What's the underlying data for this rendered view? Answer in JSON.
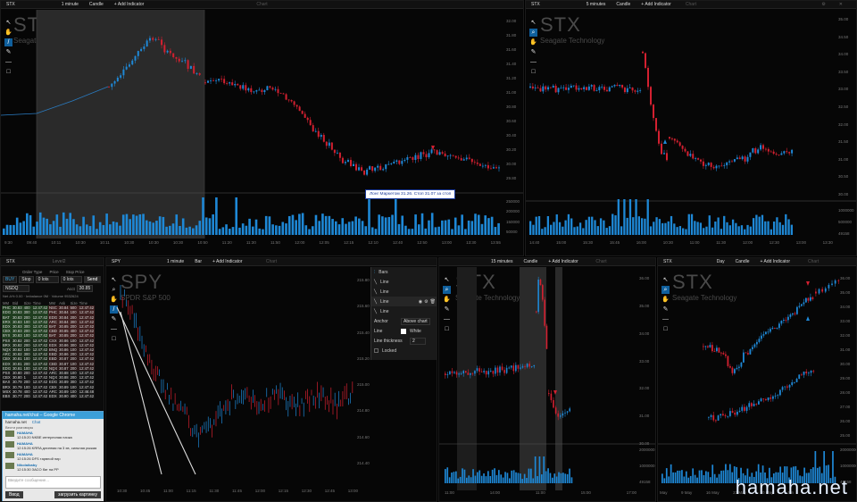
{
  "panels": {
    "top_left": {
      "symbol": "STX",
      "interval": "1 minute",
      "chart_type": "Candle",
      "add_indicator": "+ Add Indicator",
      "chart_label": "Chart",
      "big_symbol": "STX",
      "company": "Seagate Technology",
      "y_labels": [
        "32.00",
        "31.80",
        "31.60",
        "31.40",
        "31.20",
        "31.00",
        "30.80",
        "30.60",
        "30.40",
        "30.20",
        "30.00",
        "29.80"
      ],
      "vol_labels": [
        "250000",
        "200000",
        "150000",
        "50000"
      ],
      "x_labels": [
        "9:30",
        "09:40",
        "10:11",
        "10:30",
        "10:11",
        "10:30",
        "10:30",
        "10:30",
        "10:50",
        "11:20",
        "11:30",
        "11:50",
        "12:00",
        "12:05",
        "12:15",
        "12:10",
        "12:40",
        "12:50",
        "13:00",
        "13:30",
        "13:55"
      ]
    },
    "top_right": {
      "symbol": "STX",
      "interval": "5 minutes",
      "chart_type": "Candle",
      "add_indicator": "+ Add Indicator",
      "chart_label": "Chart",
      "big_symbol": "STX",
      "company": "Seagate Technology",
      "y_labels": [
        "35.00",
        "34.50",
        "34.00",
        "33.50",
        "33.00",
        "32.50",
        "32.00",
        "31.50",
        "31.00",
        "30.50",
        "30.00"
      ],
      "vol_labels": [
        "1000000",
        "500000",
        "49158"
      ],
      "x_labels": [
        "14:40",
        "15:00",
        "15:30",
        "15:45",
        "16:00",
        "10:30",
        "11:00",
        "11:30",
        "12:00",
        "12:30",
        "13:00",
        "13:30"
      ]
    },
    "bottom_mid": {
      "symbol": "SPY",
      "interval": "1 minute",
      "chart_type": "Bar",
      "add_indicator": "+ Add Indicator",
      "chart_label": "Chart",
      "big_symbol": "SPY",
      "company": "SPDR S&P 500",
      "y_labels": [
        "215.80",
        "215.60",
        "215.40",
        "215.20",
        "215.00",
        "214.80",
        "214.60",
        "214.40"
      ],
      "x_labels": [
        "10:30",
        "10:45",
        "11:00",
        "11:15",
        "11:30",
        "11:45",
        "12:00",
        "12:15",
        "12:30",
        "12:45",
        "13:00"
      ]
    },
    "bottom_right1": {
      "symbol": "STX",
      "interval": "15 minutes",
      "chart_type": "Candle",
      "add_indicator": "+ Add Indicator",
      "chart_label": "Chart",
      "big_symbol": "STX",
      "company": "Seagate Technology",
      "y_labels": [
        "36.00",
        "35.00",
        "34.00",
        "33.00",
        "32.00",
        "31.00",
        "30.00"
      ],
      "vol_labels": [
        "2000000",
        "1000000",
        "49158"
      ],
      "x_labels": [
        "11:00",
        "14:00",
        "11:00",
        "15:00",
        "17:00"
      ]
    },
    "bottom_right2": {
      "symbol": "STX",
      "interval": "Day",
      "chart_type": "Candle",
      "add_indicator": "+ Add Indicator",
      "chart_label": "Chart",
      "big_symbol": "STX",
      "company": "Seagate Technology",
      "y_labels": [
        "36.00",
        "35.00",
        "34.00",
        "33.00",
        "32.00",
        "31.00",
        "30.00",
        "29.00",
        "28.00",
        "27.00",
        "26.00",
        "25.00"
      ],
      "vol_labels": [
        "20000000",
        "10000000",
        "49158"
      ],
      "x_labels": [
        "May",
        "9 May",
        "16 May",
        "23 May",
        "30 May",
        "Jun"
      ]
    }
  },
  "tooltip": "Лонг Маркетом 31.26. Стоп 31.07 за стоп",
  "drawing_panel": {
    "header": "Bars",
    "items": [
      "Line",
      "Line",
      "Line",
      "Line"
    ],
    "anchor_label": "Anchor",
    "anchor_value": "Above chart",
    "line_label": "Line",
    "line_color": "White",
    "thickness_label": "Line thickness",
    "thickness_value": "2",
    "locked_label": "Locked"
  },
  "order_entry": {
    "symbol": "STX",
    "account_hint": "Level2",
    "labels": [
      "Order Type",
      "Price",
      "Stop Price"
    ],
    "side": "BUY",
    "order_type": "Stop",
    "price": "0 lots",
    "qty": "0 lots",
    "send": "Send",
    "acct": "NSDQ",
    "qty2": "30.85",
    "acct_label": "Acct",
    "stats": "Net Δ% 0.00 · Imbalance 0M · Volume 9532624"
  },
  "level2": {
    "headers": [
      "MM",
      "Bid",
      "Size",
      "Time",
      "MM",
      "Ask",
      "Size",
      "Time"
    ],
    "rows": [
      [
        "PHC",
        "30.83",
        "400",
        "12:47:42",
        "NSC",
        "30.84",
        "500",
        "12:47:42"
      ],
      [
        "EDG",
        "30.83",
        "300",
        "12:47:42",
        "PHC",
        "30.84",
        "100",
        "12:47:42"
      ],
      [
        "BAT",
        "30.83",
        "200",
        "12:47:42",
        "EDG",
        "30.84",
        "200",
        "12:47:42"
      ],
      [
        "ERX",
        "30.83",
        "100",
        "12:47:42",
        "ARC",
        "30.84",
        "300",
        "12:47:42"
      ],
      [
        "EDX",
        "30.83",
        "300",
        "12:47:42",
        "BAT",
        "30.85",
        "200",
        "12:47:42"
      ],
      [
        "CBX",
        "30.83",
        "200",
        "12:47:42",
        "CBD",
        "30.85",
        "400",
        "12:47:42"
      ],
      [
        "BYX",
        "30.83",
        "100",
        "12:47:42",
        "BAT",
        "30.85",
        "200",
        "12:47:42"
      ],
      [
        "PSX",
        "30.82",
        "200",
        "12:47:42",
        "CSX",
        "30.86",
        "100",
        "12:47:42"
      ],
      [
        "BRX",
        "30.82",
        "200",
        "12:47:42",
        "EDX",
        "30.86",
        "300",
        "12:47:42"
      ],
      [
        "NQX",
        "30.82",
        "100",
        "12:47:42",
        "BNQ",
        "30.86",
        "100",
        "12:47:42"
      ],
      [
        "ARC",
        "30.82",
        "300",
        "12:47:42",
        "EBD",
        "30.86",
        "200",
        "12:47:42"
      ],
      [
        "CBX",
        "30.81",
        "100",
        "12:47:42",
        "EBD",
        "30.87",
        "200",
        "12:47:42"
      ],
      [
        "EDX",
        "30.81",
        "200",
        "12:47:42",
        "CBD",
        "30.87",
        "100",
        "12:47:42"
      ],
      [
        "EDG",
        "30.81",
        "100",
        "12:47:42",
        "NQX",
        "30.87",
        "200",
        "12:47:42"
      ],
      [
        "PSX",
        "30.80",
        "200",
        "12:47:42",
        "ARC",
        "30.88",
        "100",
        "12:47:42"
      ],
      [
        "CBX",
        "30.80",
        "1",
        "12:47:42",
        "NQX",
        "30.88",
        "200",
        "12:47:42"
      ],
      [
        "BAX",
        "30.79",
        "200",
        "12:47:42",
        "EDG",
        "30.89",
        "300",
        "12:47:42"
      ],
      [
        "BRX",
        "30.79",
        "100",
        "12:47:42",
        "CBX",
        "30.89",
        "100",
        "12:47:42"
      ],
      [
        "MSX",
        "30.78",
        "400",
        "12:47:42",
        "ARC",
        "30.89",
        "100",
        "12:46:48"
      ],
      [
        "EBX",
        "30.77",
        "200",
        "12:47:42",
        "EDX",
        "30.90",
        "400",
        "12:47:42"
      ]
    ]
  },
  "chat": {
    "title": "hamaha.net/chat – Google Chrome",
    "url": "hamaha.net",
    "tab": "Chat",
    "subtitle": "Вести разговоры",
    "messages": [
      {
        "name": "HAMAHA",
        "text": "12:15:20 NKBE интересная пачка"
      },
      {
        "name": "HAMAHA",
        "text": "12:15:26 KRRA длинная на 3 хв, сильная рыжая"
      },
      {
        "name": "HAMAHA",
        "text": "12:15:26 DFS тарвной пир"
      },
      {
        "name": "Nikolaibaby",
        "text": "12:15:30 ЗАСО биг на РР"
      }
    ],
    "input_placeholder": "Введите сообщение...",
    "send_label": "Ввод",
    "upload_label": "загрузить картинку"
  },
  "watermark": "hamaha.net"
}
